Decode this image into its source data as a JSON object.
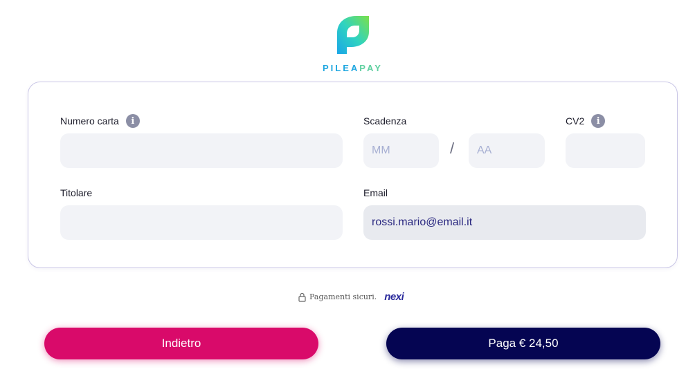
{
  "brand": {
    "name_part1": "PILEA",
    "name_part2": "PAY"
  },
  "form": {
    "card_number_label": "Numero carta",
    "expiry_label": "Scadenza",
    "expiry_month_placeholder": "MM",
    "expiry_separator": "/",
    "expiry_year_placeholder": "AA",
    "cvv_label": "CV2",
    "holder_label": "Titolare",
    "email_label": "Email",
    "email_value": "rossi.mario@email.it",
    "info_icon_glyph": "i"
  },
  "footer": {
    "secure_text": "Pagamenti sicuri.",
    "provider": "nexi"
  },
  "buttons": {
    "back_label": "Indietro",
    "pay_label": "Paga € 24,50"
  },
  "colors": {
    "back_button": "#d90a6a",
    "pay_button": "#050552",
    "field_bg": "#f2f3f7"
  }
}
